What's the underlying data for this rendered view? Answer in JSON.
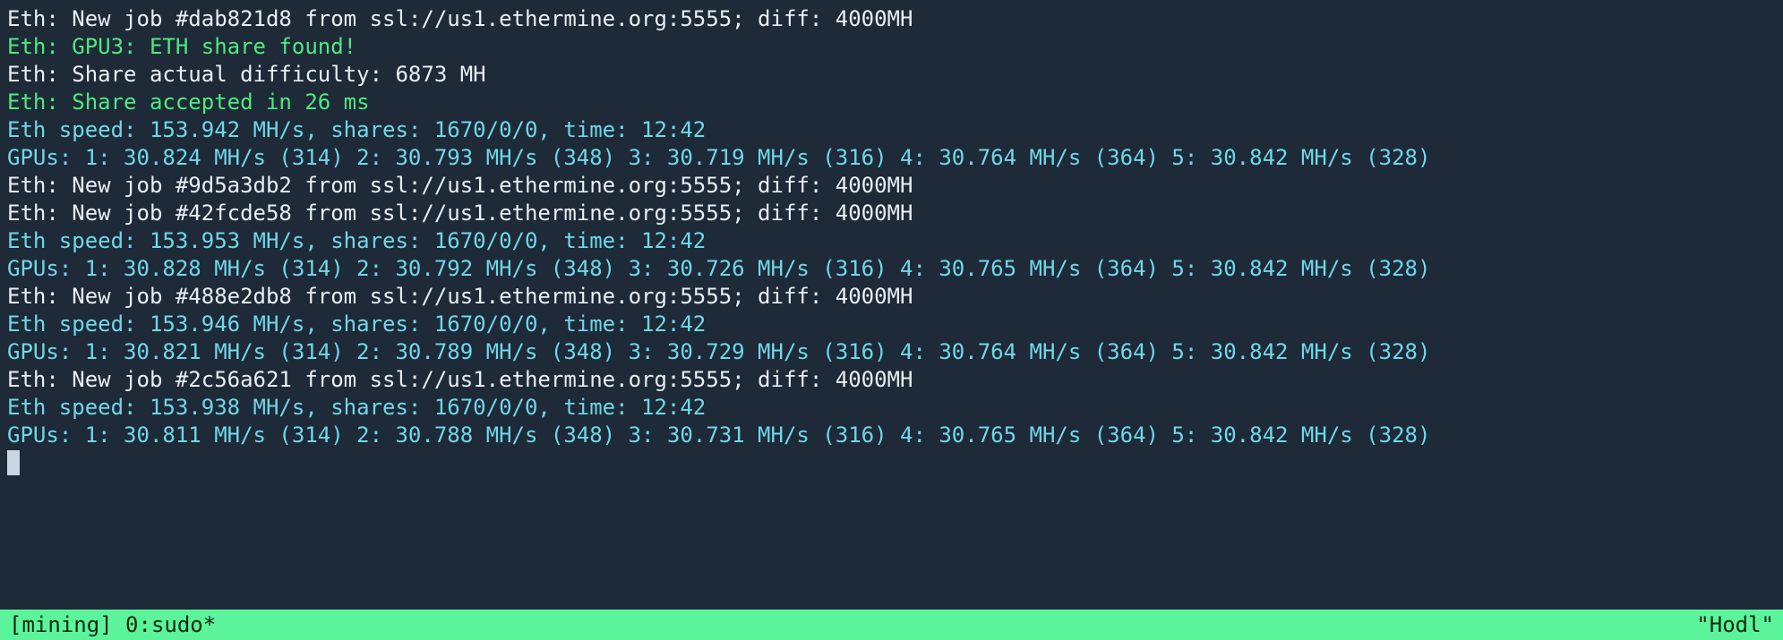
{
  "colors": {
    "bg": "#1e2a38",
    "text_default": "#cbd6e2",
    "text_white": "#e8eef4",
    "text_green": "#4fe87e",
    "text_cyan": "#6fd7e8",
    "status_bg": "#5cf49a",
    "status_fg": "#0c2a12"
  },
  "lines": [
    {
      "cls": "c-white",
      "text": "Eth: New job #dab821d8 from ssl://us1.ethermine.org:5555; diff: 4000MH"
    },
    {
      "cls": "c-green",
      "text": "Eth: GPU3: ETH share found!"
    },
    {
      "cls": "c-white",
      "text": "Eth: Share actual difficulty: 6873 MH"
    },
    {
      "cls": "c-green",
      "text": "Eth: Share accepted in 26 ms"
    },
    {
      "cls": "c-cyan",
      "text": "Eth speed: 153.942 MH/s, shares: 1670/0/0, time: 12:42"
    },
    {
      "cls": "c-cyan",
      "text": "GPUs: 1: 30.824 MH/s (314) 2: 30.793 MH/s (348) 3: 30.719 MH/s (316) 4: 30.764 MH/s (364) 5: 30.842 MH/s (328)"
    },
    {
      "cls": "c-white",
      "text": "Eth: New job #9d5a3db2 from ssl://us1.ethermine.org:5555; diff: 4000MH"
    },
    {
      "cls": "c-white",
      "text": "Eth: New job #42fcde58 from ssl://us1.ethermine.org:5555; diff: 4000MH"
    },
    {
      "cls": "c-cyan",
      "text": "Eth speed: 153.953 MH/s, shares: 1670/0/0, time: 12:42"
    },
    {
      "cls": "c-cyan",
      "text": "GPUs: 1: 30.828 MH/s (314) 2: 30.792 MH/s (348) 3: 30.726 MH/s (316) 4: 30.765 MH/s (364) 5: 30.842 MH/s (328)"
    },
    {
      "cls": "c-white",
      "text": "Eth: New job #488e2db8 from ssl://us1.ethermine.org:5555; diff: 4000MH"
    },
    {
      "cls": "c-cyan",
      "text": "Eth speed: 153.946 MH/s, shares: 1670/0/0, time: 12:42"
    },
    {
      "cls": "c-cyan",
      "text": "GPUs: 1: 30.821 MH/s (314) 2: 30.789 MH/s (348) 3: 30.729 MH/s (316) 4: 30.764 MH/s (364) 5: 30.842 MH/s (328)"
    },
    {
      "cls": "c-white",
      "text": "Eth: New job #2c56a621 from ssl://us1.ethermine.org:5555; diff: 4000MH"
    },
    {
      "cls": "c-cyan",
      "text": "Eth speed: 153.938 MH/s, shares: 1670/0/0, time: 12:42"
    },
    {
      "cls": "c-cyan",
      "text": "GPUs: 1: 30.811 MH/s (314) 2: 30.788 MH/s (348) 3: 30.731 MH/s (316) 4: 30.765 MH/s (364) 5: 30.842 MH/s (328)"
    }
  ],
  "statusbar": {
    "left": "[mining] 0:sudo*",
    "right": "\"Hodl\""
  }
}
